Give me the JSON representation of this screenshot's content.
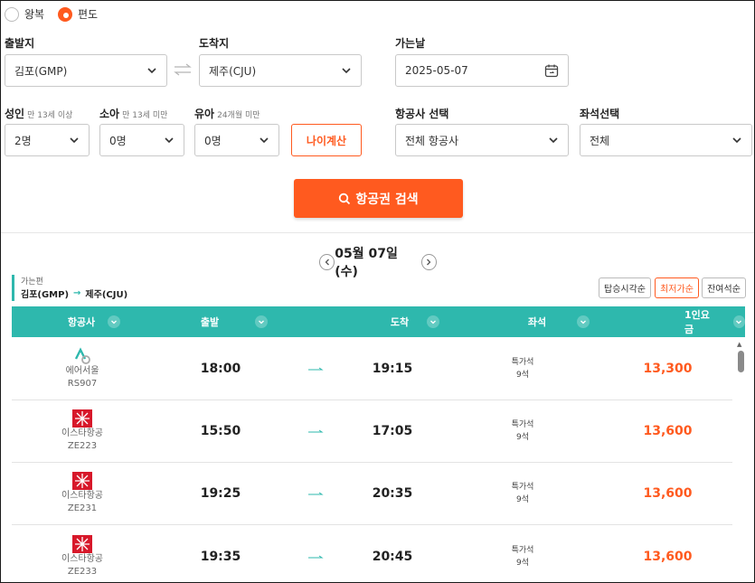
{
  "trip_type": {
    "round": "왕복",
    "oneway": "편도",
    "selected": "oneway"
  },
  "form": {
    "departure": {
      "label": "출발지",
      "value": "김포(GMP)"
    },
    "arrival": {
      "label": "도착지",
      "value": "제주(CJU)"
    },
    "date": {
      "label": "가는날",
      "value": "2025-05-07"
    },
    "adult": {
      "label": "성인",
      "hint": "만 13세 이상",
      "value": "2명"
    },
    "child": {
      "label": "소아",
      "hint": "만 13세 미만",
      "value": "0명"
    },
    "infant": {
      "label": "유아",
      "hint": "24개월 미만",
      "value": "0명"
    },
    "age_calc": "나이계산",
    "airline": {
      "label": "항공사 선택",
      "value": "전체 항공사"
    },
    "seat_class": {
      "label": "좌석선택",
      "value": "전체"
    },
    "search": "항공권 검색"
  },
  "results": {
    "date_title": "05월 07일 (수)",
    "route_label": "가는편",
    "route_from": "김포(GMP)",
    "route_arrow": "→",
    "route_to": "제주(CJU)",
    "sort": [
      "탑승시각순",
      "최저가순",
      "잔여석순"
    ],
    "sort_selected": 1,
    "columns": [
      "항공사",
      "출발",
      "도착",
      "좌석",
      "1인요금"
    ],
    "rows": [
      {
        "airline": "에어서울",
        "flight": "RS907",
        "depart": "18:00",
        "arrive": "19:15",
        "seat_class": "특가석",
        "seats": "9석",
        "fare": "13,300",
        "logo": "airseoul"
      },
      {
        "airline": "이스타항공",
        "flight": "ZE223",
        "depart": "15:50",
        "arrive": "17:05",
        "seat_class": "특가석",
        "seats": "9석",
        "fare": "13,600",
        "logo": "eastar"
      },
      {
        "airline": "이스타항공",
        "flight": "ZE231",
        "depart": "19:25",
        "arrive": "20:35",
        "seat_class": "특가석",
        "seats": "9석",
        "fare": "13,600",
        "logo": "eastar"
      },
      {
        "airline": "이스타항공",
        "flight": "ZE233",
        "depart": "19:35",
        "arrive": "20:45",
        "seat_class": "특가석",
        "seats": "9석",
        "fare": "13,600",
        "logo": "eastar"
      }
    ]
  },
  "colors": {
    "accent": "#ff5a1f",
    "teal": "#2eb8ad",
    "eastar_red": "#d7182a"
  }
}
